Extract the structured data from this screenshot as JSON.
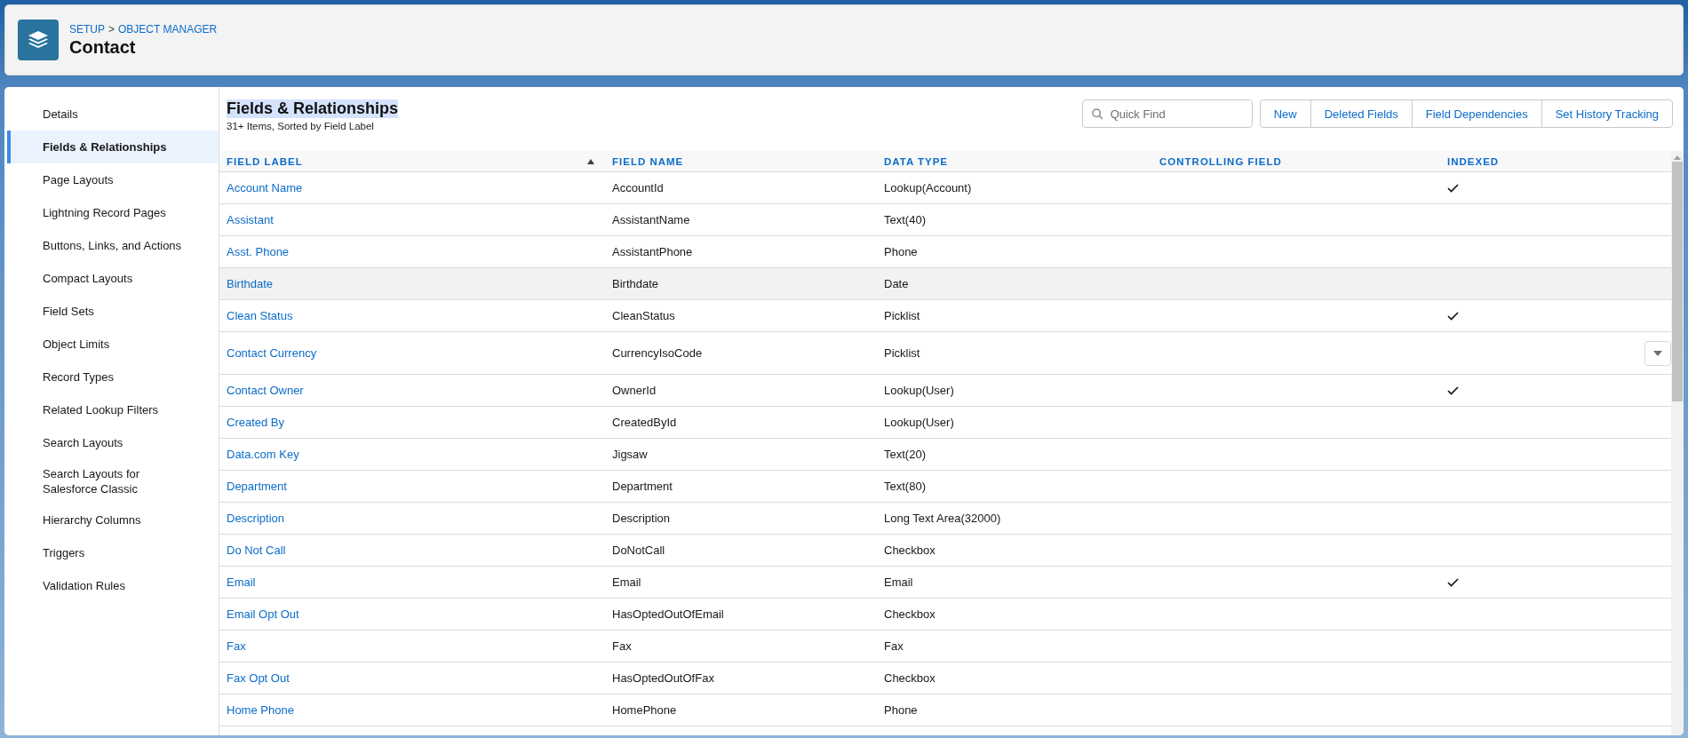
{
  "header": {
    "breadcrumb": [
      {
        "label": "SETUP"
      },
      {
        "label": "OBJECT MANAGER"
      }
    ],
    "separator": ">",
    "title": "Contact"
  },
  "sidebar": {
    "items": [
      {
        "label": "Details",
        "selected": false
      },
      {
        "label": "Fields & Relationships",
        "selected": true
      },
      {
        "label": "Page Layouts",
        "selected": false
      },
      {
        "label": "Lightning Record Pages",
        "selected": false
      },
      {
        "label": "Buttons, Links, and Actions",
        "selected": false
      },
      {
        "label": "Compact Layouts",
        "selected": false
      },
      {
        "label": "Field Sets",
        "selected": false
      },
      {
        "label": "Object Limits",
        "selected": false
      },
      {
        "label": "Record Types",
        "selected": false
      },
      {
        "label": "Related Lookup Filters",
        "selected": false
      },
      {
        "label": "Search Layouts",
        "selected": false
      },
      {
        "label": "Search Layouts for Salesforce Classic",
        "selected": false
      },
      {
        "label": "Hierarchy Columns",
        "selected": false
      },
      {
        "label": "Triggers",
        "selected": false
      },
      {
        "label": "Validation Rules",
        "selected": false
      }
    ]
  },
  "section": {
    "title": "Fields & Relationships",
    "subtitle": "31+ Items, Sorted by Field Label",
    "search": {
      "placeholder": "Quick Find"
    },
    "buttons": [
      "New",
      "Deleted Fields",
      "Field Dependencies",
      "Set History Tracking"
    ]
  },
  "table": {
    "columns": [
      {
        "label": "FIELD LABEL",
        "sorted": true
      },
      {
        "label": "FIELD NAME",
        "sorted": false
      },
      {
        "label": "DATA TYPE",
        "sorted": false
      },
      {
        "label": "CONTROLLING FIELD",
        "sorted": false
      },
      {
        "label": "INDEXED",
        "sorted": false
      }
    ],
    "rows": [
      {
        "label": "Account Name",
        "name": "AccountId",
        "type": "Lookup(Account)",
        "indexed": true,
        "highlighted": false,
        "menu": false
      },
      {
        "label": "Assistant",
        "name": "AssistantName",
        "type": "Text(40)",
        "indexed": false,
        "highlighted": false,
        "menu": false
      },
      {
        "label": "Asst. Phone",
        "name": "AssistantPhone",
        "type": "Phone",
        "indexed": false,
        "highlighted": false,
        "menu": false
      },
      {
        "label": "Birthdate",
        "name": "Birthdate",
        "type": "Date",
        "indexed": false,
        "highlighted": true,
        "menu": false
      },
      {
        "label": "Clean Status",
        "name": "CleanStatus",
        "type": "Picklist",
        "indexed": true,
        "highlighted": false,
        "menu": false
      },
      {
        "label": "Contact Currency",
        "name": "CurrencyIsoCode",
        "type": "Picklist",
        "indexed": false,
        "highlighted": false,
        "menu": true
      },
      {
        "label": "Contact Owner",
        "name": "OwnerId",
        "type": "Lookup(User)",
        "indexed": true,
        "highlighted": false,
        "menu": false
      },
      {
        "label": "Created By",
        "name": "CreatedById",
        "type": "Lookup(User)",
        "indexed": false,
        "highlighted": false,
        "menu": false
      },
      {
        "label": "Data.com Key",
        "name": "Jigsaw",
        "type": "Text(20)",
        "indexed": false,
        "highlighted": false,
        "menu": false
      },
      {
        "label": "Department",
        "name": "Department",
        "type": "Text(80)",
        "indexed": false,
        "highlighted": false,
        "menu": false
      },
      {
        "label": "Description",
        "name": "Description",
        "type": "Long Text Area(32000)",
        "indexed": false,
        "highlighted": false,
        "menu": false
      },
      {
        "label": "Do Not Call",
        "name": "DoNotCall",
        "type": "Checkbox",
        "indexed": false,
        "highlighted": false,
        "menu": false
      },
      {
        "label": "Email",
        "name": "Email",
        "type": "Email",
        "indexed": true,
        "highlighted": false,
        "menu": false
      },
      {
        "label": "Email Opt Out",
        "name": "HasOptedOutOfEmail",
        "type": "Checkbox",
        "indexed": false,
        "highlighted": false,
        "menu": false
      },
      {
        "label": "Fax",
        "name": "Fax",
        "type": "Fax",
        "indexed": false,
        "highlighted": false,
        "menu": false
      },
      {
        "label": "Fax Opt Out",
        "name": "HasOptedOutOfFax",
        "type": "Checkbox",
        "indexed": false,
        "highlighted": false,
        "menu": false
      },
      {
        "label": "Home Phone",
        "name": "HomePhone",
        "type": "Phone",
        "indexed": false,
        "highlighted": false,
        "menu": false
      }
    ]
  }
}
